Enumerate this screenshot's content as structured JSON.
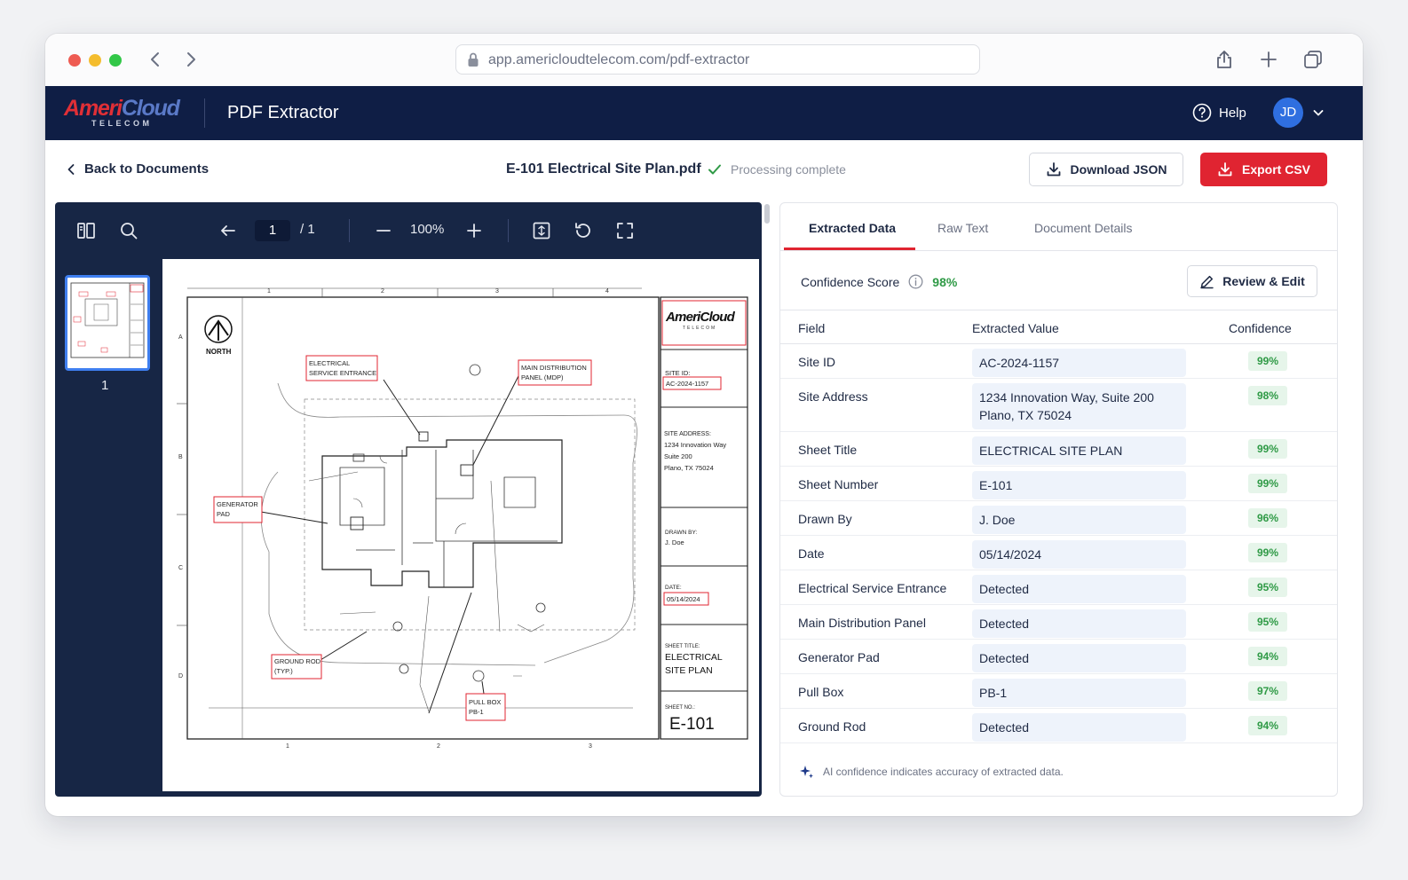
{
  "browser": {
    "url": "app.americloudtelecom.com/pdf-extractor"
  },
  "header": {
    "logo_part1": "Ameri",
    "logo_part2": "Cloud",
    "logo_sub": "TELECOM",
    "app_title": "PDF Extractor",
    "help_label": "Help",
    "avatar_initials": "JD"
  },
  "toolbar": {
    "back_label": "Back to Documents",
    "document_name": "E-101 Electrical Site Plan.pdf",
    "status": "Processing complete",
    "download_label": "Download JSON",
    "export_label": "Export CSV"
  },
  "viewer": {
    "page_current": "1",
    "page_total": "/ 1",
    "zoom": "100%",
    "thumb_label": "1"
  },
  "plan": {
    "col_labels": [
      "1",
      "2",
      "3",
      "4"
    ],
    "row_labels": [
      "A",
      "B",
      "C",
      "D"
    ],
    "north": "NORTH",
    "callouts": {
      "service_entrance_1": "ELECTRICAL",
      "service_entrance_2": "SERVICE ENTRANCE",
      "mdp_1": "MAIN DISTRIBUTION",
      "mdp_2": "PANEL (MDP)",
      "generator_1": "GENERATOR",
      "generator_2": "PAD",
      "ground_rod_1": "GROUND ROD",
      "ground_rod_2": "(TYP.)",
      "pull_box_1": "PULL BOX",
      "pull_box_2": "PB-1"
    },
    "title_block": {
      "logo_part1": "Ameri",
      "logo_part2": "Cloud",
      "logo_sub": "TELECOM",
      "site_id_label": "SITE ID:",
      "site_id": "AC-2024-1157",
      "address_label": "SITE ADDRESS:",
      "address_1": "1234 Innovation Way",
      "address_2": "Suite 200",
      "address_3": "Plano, TX 75024",
      "drawn_by_label": "DRAWN BY:",
      "drawn_by": "J. Doe",
      "date_label": "DATE:",
      "date": "05/14/2024",
      "sheet_title_label": "SHEET TITLE:",
      "sheet_title_1": "ELECTRICAL",
      "sheet_title_2": "SITE PLAN",
      "sheet_no_label": "SHEET NO.:",
      "sheet_no": "E-101"
    }
  },
  "panel": {
    "tabs": [
      "Extracted Data",
      "Raw Text",
      "Document Details"
    ],
    "confidence_label": "Confidence Score",
    "confidence_value": "98%",
    "review_label": "Review & Edit",
    "columns": [
      "Field",
      "Extracted Value",
      "Confidence"
    ],
    "rows": [
      {
        "field": "Site ID",
        "value": "AC-2024-1157",
        "confidence": "99%"
      },
      {
        "field": "Site Address",
        "value": "1234 Innovation Way, Suite 200 Plano, TX 75024",
        "confidence": "98%"
      },
      {
        "field": "Sheet Title",
        "value": "ELECTRICAL SITE PLAN",
        "confidence": "99%"
      },
      {
        "field": "Sheet Number",
        "value": "E-101",
        "confidence": "99%"
      },
      {
        "field": "Drawn By",
        "value": "J. Doe",
        "confidence": "96%"
      },
      {
        "field": "Date",
        "value": "05/14/2024",
        "confidence": "99%"
      },
      {
        "field": "Electrical Service Entrance",
        "value": "Detected",
        "confidence": "95%"
      },
      {
        "field": "Main Distribution Panel",
        "value": "Detected",
        "confidence": "95%"
      },
      {
        "field": "Generator Pad",
        "value": "Detected",
        "confidence": "94%"
      },
      {
        "field": "Pull Box",
        "value": "PB-1",
        "confidence": "97%"
      },
      {
        "field": "Ground Rod",
        "value": "Detected",
        "confidence": "94%"
      }
    ],
    "footnote": "AI confidence indicates accuracy of extracted data."
  },
  "colors": {
    "navy": "#0f1e45",
    "viewer_bg": "#172645",
    "accent_red": "#e02431",
    "accent_blue": "#2f6fe0",
    "confidence_green": "#2f9a46"
  },
  "icons": [
    "lock-icon",
    "back-icon",
    "forward-icon",
    "share-icon",
    "new-tab-icon",
    "tabs-icon",
    "help-icon",
    "chevron-down-icon",
    "chevron-left-icon",
    "check-icon",
    "download-icon",
    "sidebar-toggle-icon",
    "search-icon",
    "previous-page-icon",
    "zoom-out-icon",
    "zoom-in-icon",
    "fit-page-icon",
    "rotate-icon",
    "fullscreen-icon",
    "info-icon",
    "pencil-icon",
    "sparkle-icon"
  ]
}
